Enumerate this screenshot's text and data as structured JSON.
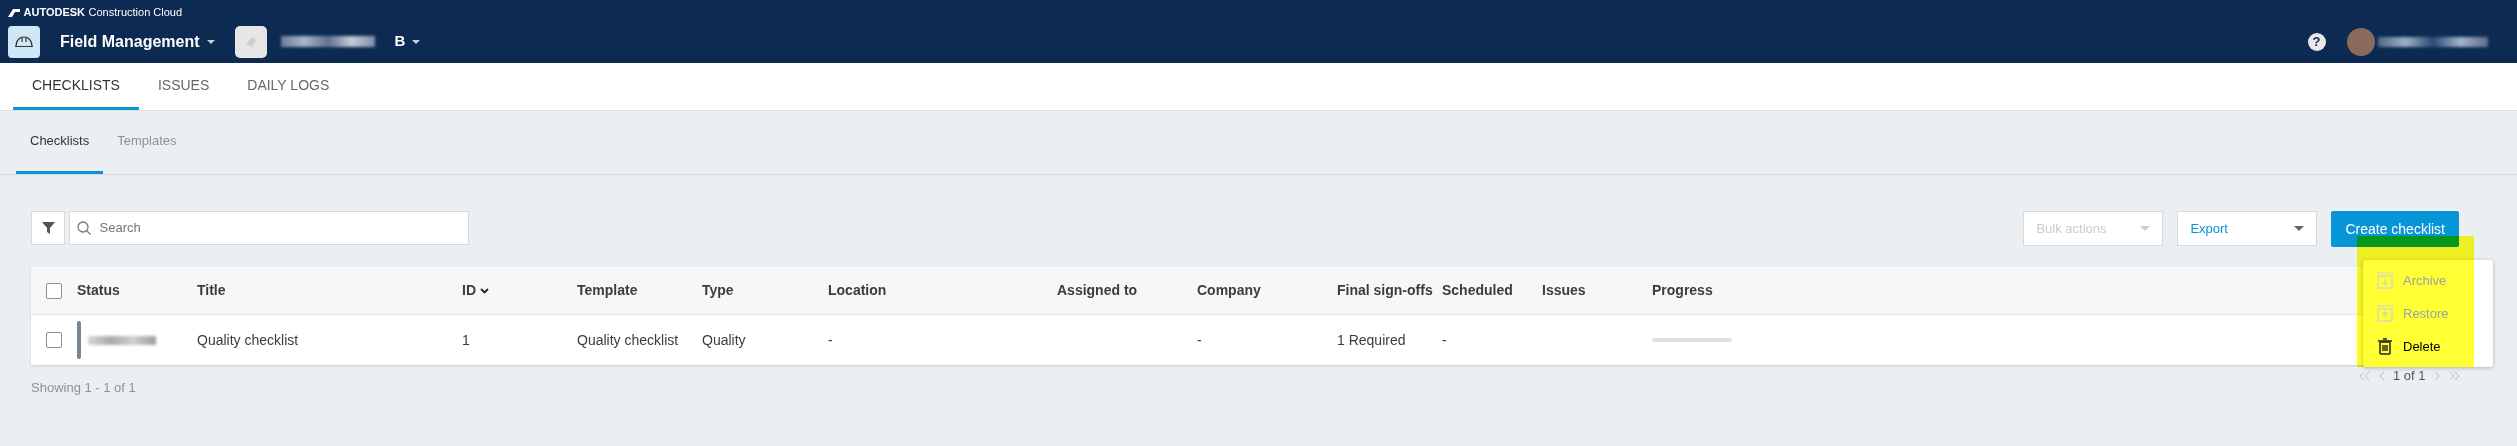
{
  "header": {
    "brand": "AUTODESK",
    "product": "Construction Cloud",
    "app": "Field Management",
    "project_suffix": "B",
    "help": "?"
  },
  "tabs": [
    {
      "label": "CHECKLISTS",
      "selected": true
    },
    {
      "label": "ISSUES",
      "selected": false
    },
    {
      "label": "DAILY LOGS",
      "selected": false
    }
  ],
  "subtabs": [
    {
      "label": "Checklists",
      "selected": true
    },
    {
      "label": "Templates",
      "selected": false
    }
  ],
  "search": {
    "placeholder": "Search"
  },
  "toolbar": {
    "bulk_actions": {
      "label": "Bulk actions",
      "disabled": true
    },
    "export": "Export",
    "create": "Create checklist"
  },
  "table": {
    "select_all": {
      "checked": false
    },
    "columns": [
      {
        "label": "Status",
        "sorted": false
      },
      {
        "label": "Title",
        "sorted": false
      },
      {
        "label": "ID",
        "sorted": true
      },
      {
        "label": "Template",
        "sorted": false
      },
      {
        "label": "Type",
        "sorted": false
      },
      {
        "label": "Location",
        "sorted": false
      },
      {
        "label": "Assigned to",
        "sorted": false
      },
      {
        "label": "Company",
        "sorted": false
      },
      {
        "label": "Final sign-offs",
        "sorted": false
      },
      {
        "label": "Scheduled",
        "sorted": false
      },
      {
        "label": "Issues",
        "sorted": false
      },
      {
        "label": "Progress",
        "sorted": false
      }
    ],
    "rows": [
      {
        "checked": false,
        "cells": {
          "title": "Quality checklist",
          "id": "1",
          "template": "Quality checklist",
          "type": "Quality",
          "location": "-",
          "company": "-",
          "final_signoffs": "1 Required",
          "scheduled": "-"
        },
        "progress": {
          "level": 0
        }
      }
    ]
  },
  "menu": {
    "items": [
      {
        "label": "Archive",
        "kind": "archive",
        "disabled": true
      },
      {
        "label": "Restore",
        "kind": "restore",
        "disabled": true
      },
      {
        "label": "Delete",
        "kind": "delete",
        "disabled": false
      }
    ]
  },
  "pagination": {
    "label": "1 of 1"
  },
  "footer": "Showing 1 - 1 of 1"
}
